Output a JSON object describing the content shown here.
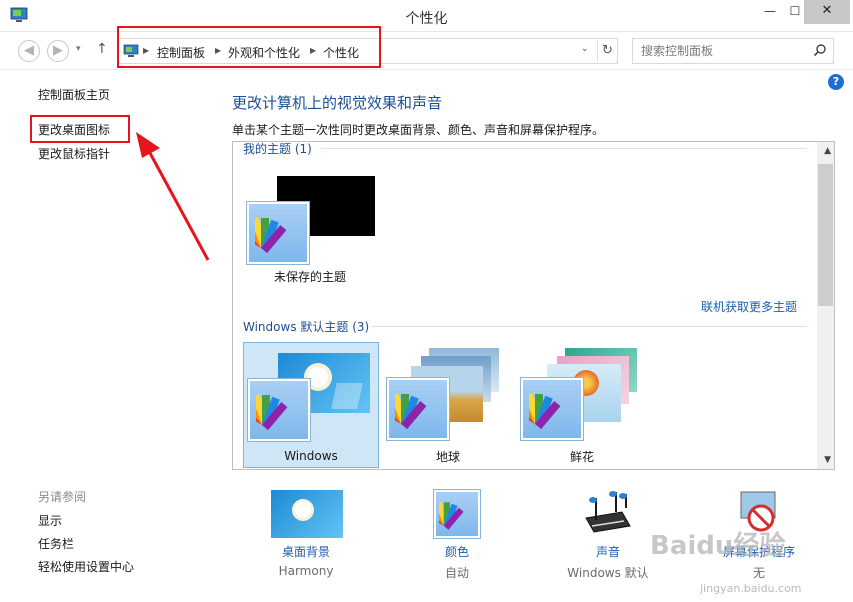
{
  "window": {
    "title": "个性化",
    "min_label": "—",
    "max_label": "☐",
    "close_label": "✕"
  },
  "nav": {
    "back_icon": "◀",
    "forward_icon": "▶",
    "recent_icon": "▾",
    "up_icon": "↑",
    "breadcrumbs": [
      "控制面板",
      "外观和个性化",
      "个性化"
    ],
    "dropdown_icon": "⌄",
    "refresh_icon": "↻",
    "search_placeholder": "搜索控制面板"
  },
  "help_label": "?",
  "sidebar": {
    "home": "控制面板主页",
    "desktop_icons": "更改桌面图标",
    "mouse_pointers": "更改鼠标指针",
    "see_also_heading": "另请参阅",
    "see_also": [
      "显示",
      "任务栏",
      "轻松使用设置中心"
    ]
  },
  "main": {
    "title": "更改计算机上的视觉效果和声音",
    "description": "单击某个主题一次性同时更改桌面背景、颜色、声音和屏幕保护程序。"
  },
  "themes": {
    "my_group": "我的主题 (1)",
    "my_themes": [
      {
        "label": "未保存的主题"
      }
    ],
    "more_online": "联机获取更多主题",
    "default_group": "Windows 默认主题 (3)",
    "default_themes": [
      {
        "label": "Windows",
        "selected": true
      },
      {
        "label": "地球",
        "selected": false
      },
      {
        "label": "鲜花",
        "selected": false
      }
    ]
  },
  "tools": [
    {
      "label": "桌面背景",
      "sub": "Harmony"
    },
    {
      "label": "颜色",
      "sub": "自动"
    },
    {
      "label": "声音",
      "sub": "Windows 默认"
    },
    {
      "label": "屏幕保护程序",
      "sub": "无"
    }
  ],
  "watermark": {
    "text": "Baidu经验",
    "sub": "jingyan.baidu.com"
  },
  "colors": {
    "accent_link": "#1d5fb0",
    "heading": "#1d4f91",
    "highlight_red": "#e8141b",
    "selected_tile": "#cfe6f6"
  }
}
